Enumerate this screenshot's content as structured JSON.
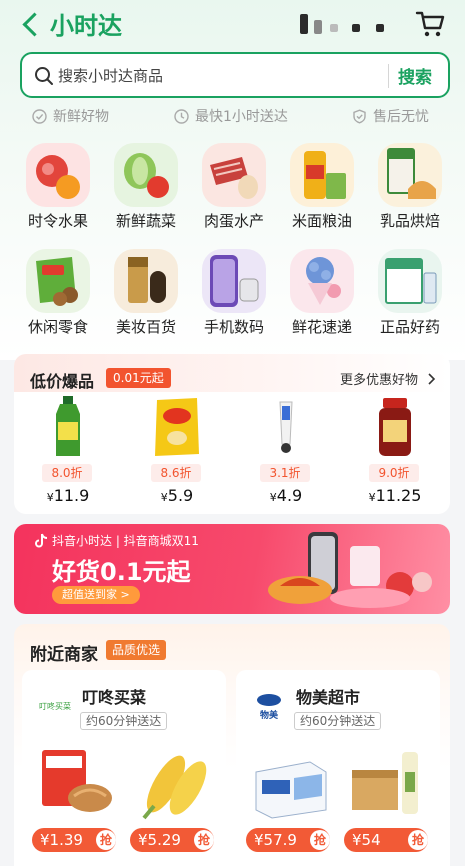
{
  "header": {
    "title": "小时达"
  },
  "search": {
    "placeholder": "搜索小时达商品",
    "button": "搜索"
  },
  "features": [
    "新鲜好物",
    "最快1小时送达",
    "售后无忧"
  ],
  "categories": [
    {
      "label": "时令水果",
      "icon": "fruit-icon"
    },
    {
      "label": "新鲜蔬菜",
      "icon": "vegetable-icon"
    },
    {
      "label": "肉蛋水产",
      "icon": "meat-egg-icon"
    },
    {
      "label": "米面粮油",
      "icon": "grain-oil-icon"
    },
    {
      "label": "乳品烘焙",
      "icon": "dairy-bakery-icon"
    },
    {
      "label": "休闲零食",
      "icon": "snack-icon"
    },
    {
      "label": "美妆百货",
      "icon": "cosmetics-icon"
    },
    {
      "label": "手机数码",
      "icon": "phone-digital-icon"
    },
    {
      "label": "鲜花速递",
      "icon": "flower-icon"
    },
    {
      "label": "正品好药",
      "icon": "medicine-icon"
    }
  ],
  "deals": {
    "title": "低价爆品",
    "badge": "0.01元起",
    "more": "更多优惠好物",
    "items": [
      {
        "discount": "8.0折",
        "currency": "¥",
        "price": "11.9",
        "icon": "bottle-drink-icon"
      },
      {
        "discount": "8.6折",
        "currency": "¥",
        "price": "5.9",
        "icon": "chips-bag-icon"
      },
      {
        "discount": "3.1折",
        "currency": "¥",
        "price": "4.9",
        "icon": "tube-icon"
      },
      {
        "discount": "9.0折",
        "currency": "¥",
        "price": "11.25",
        "icon": "sauce-jar-icon"
      }
    ]
  },
  "banner": {
    "top_text": "抖音小时达 | 抖音商城双11",
    "headline": "好货0.1元起",
    "pill": "超值送到家 >"
  },
  "nearby": {
    "title": "附近商家",
    "badge": "品质优选",
    "stores": [
      {
        "name": "叮咚买菜",
        "logo_text": "叮咚买菜",
        "time": "约60分钟送达",
        "products": [
          {
            "price": "¥1.39",
            "grab": "抢",
            "icon": "instant-noodle-icon"
          },
          {
            "price": "¥5.29",
            "grab": "抢",
            "icon": "corn-icon"
          }
        ]
      },
      {
        "name": "物美超市",
        "logo_text": "物美",
        "time": "约60分钟送达",
        "products": [
          {
            "price": "¥57.9",
            "grab": "抢",
            "icon": "milk-box-icon"
          },
          {
            "price": "¥54",
            "grab": "抢",
            "icon": "tea-case-icon"
          }
        ]
      }
    ]
  },
  "colors": {
    "accent": "#1aa260",
    "promo": "#f2542f",
    "banner": "#f4335d"
  }
}
